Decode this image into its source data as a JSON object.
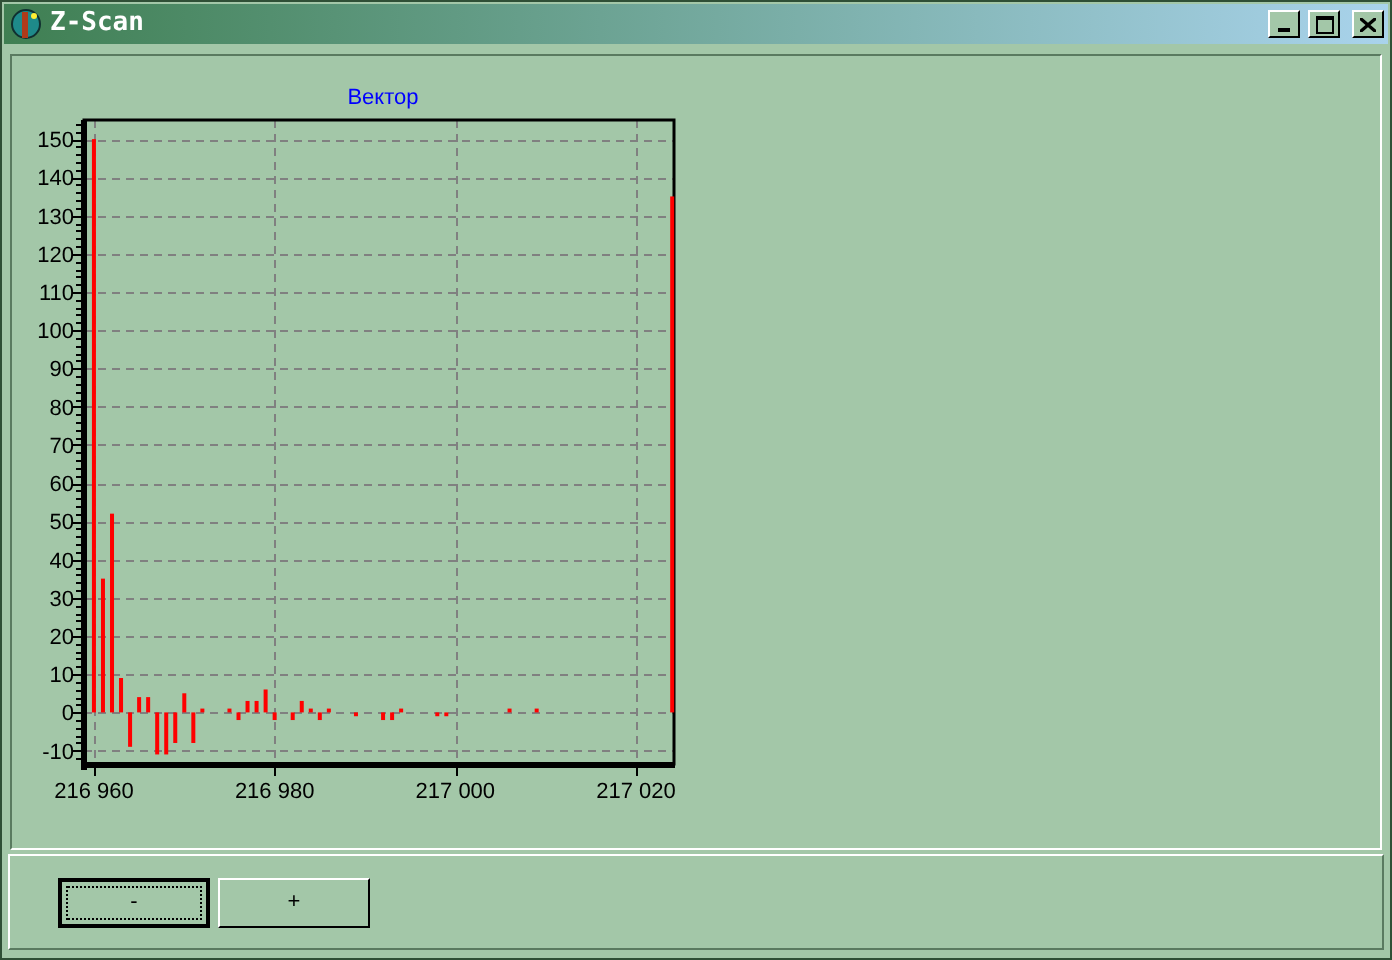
{
  "window": {
    "title": "Z-Scan"
  },
  "chart": {
    "chart_data": {
      "type": "bar",
      "title": "Вектор",
      "grid": true,
      "xlim": [
        216958.9,
        217024.2
      ],
      "ylim": [
        -13.5,
        155
      ],
      "xticks": [
        {
          "value": 216960,
          "label": "216 960"
        },
        {
          "value": 216980,
          "label": "216 980"
        },
        {
          "value": 217000,
          "label": "217 000"
        },
        {
          "value": 217020,
          "label": "217 020"
        }
      ],
      "yticks": [
        -10,
        0,
        10,
        20,
        30,
        40,
        50,
        60,
        70,
        80,
        90,
        100,
        110,
        120,
        130,
        140,
        150
      ],
      "x": [
        216960,
        216961,
        216962,
        216963,
        216964,
        216965,
        216966,
        216967,
        216968,
        216969,
        216970,
        216971,
        216972,
        216975,
        216976,
        216977,
        216978,
        216979,
        216980,
        216982,
        216983,
        216984,
        216985,
        216986,
        216989,
        216992,
        216993,
        216994,
        216998,
        216999,
        217006,
        217009,
        217024
      ],
      "series": [
        {
          "color": "#ff0000",
          "values": [
            150,
            35,
            52,
            9,
            -9,
            4,
            4,
            -11,
            -11,
            -8,
            5,
            -8,
            1,
            1,
            -2,
            3,
            3,
            6,
            -2,
            -2,
            3,
            1,
            -2,
            1,
            -1,
            -2,
            -2,
            1,
            -1,
            -1,
            1,
            1,
            135
          ]
        }
      ]
    }
  },
  "buttons": [
    {
      "label": "-",
      "focused": true
    },
    {
      "label": "+",
      "focused": false
    }
  ]
}
